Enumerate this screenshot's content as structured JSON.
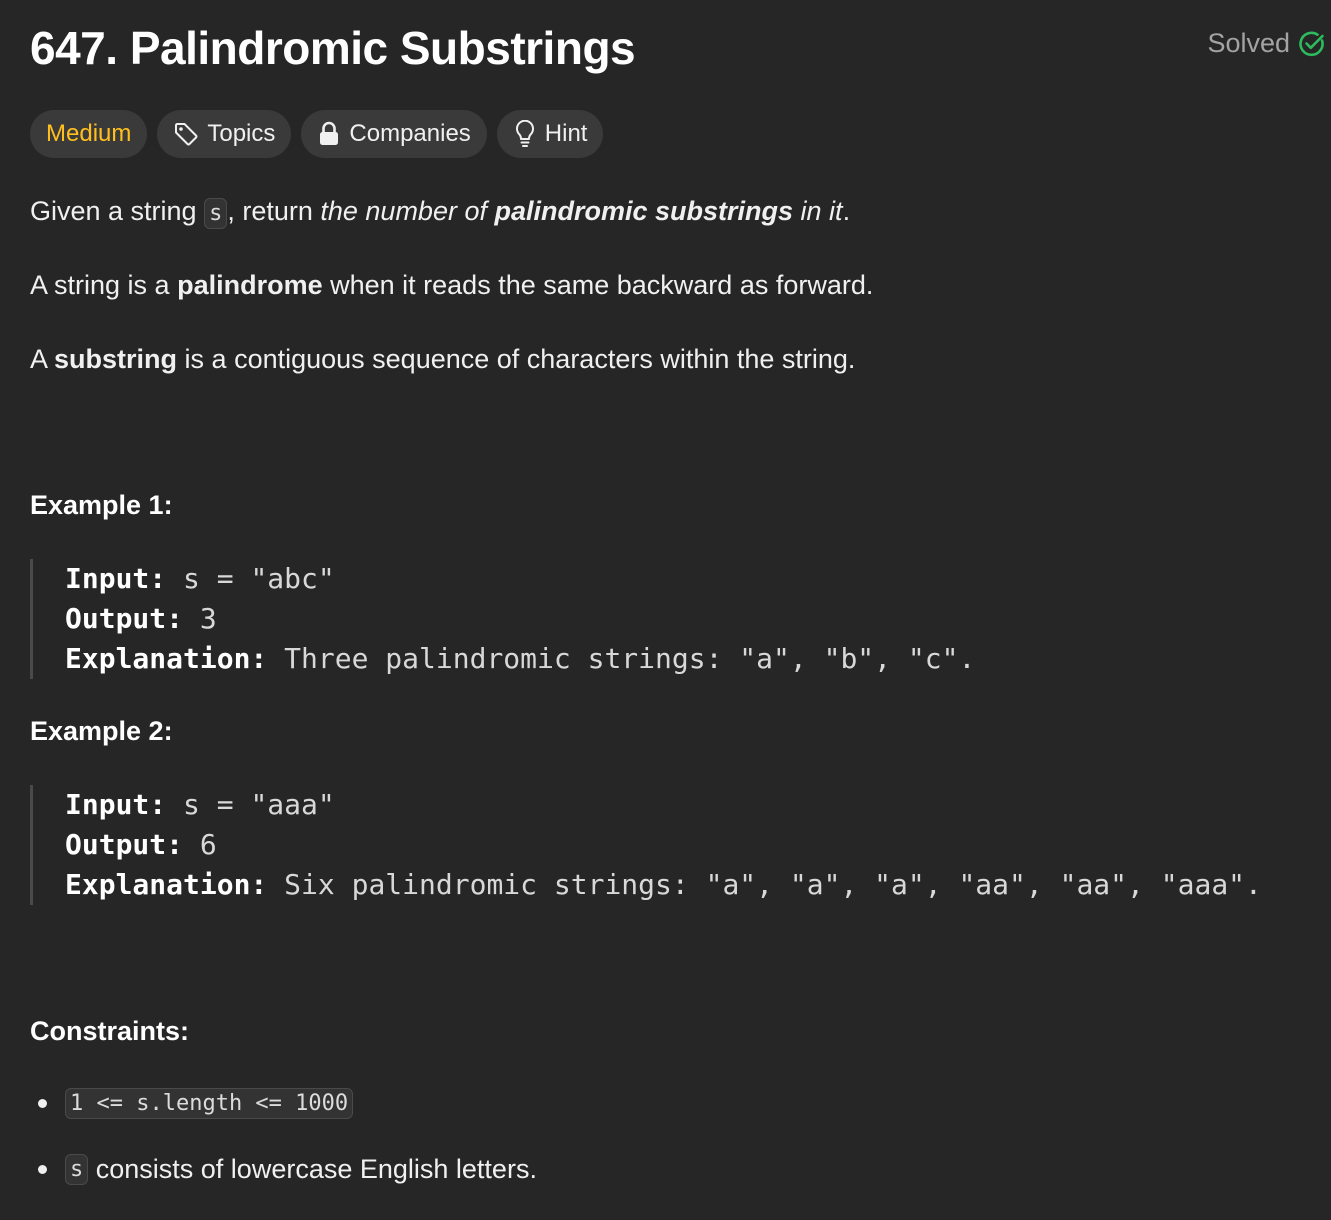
{
  "problem": {
    "number": "647.",
    "title": "Palindromic Substrings",
    "status": "Solved",
    "colors": {
      "background": "#262626",
      "difficulty": "#ffc01e",
      "solved_check": "#2cbb5d"
    }
  },
  "tags": {
    "difficulty": "Medium",
    "topics": "Topics",
    "companies": "Companies",
    "hint": "Hint",
    "topics_icon": "tag-icon",
    "companies_icon": "lock-icon",
    "hint_icon": "lightbulb-icon"
  },
  "description": {
    "p1_a": "Given a string ",
    "p1_code": "s",
    "p1_b": ", return ",
    "p1_c": "the number of ",
    "p1_d": "palindromic substrings",
    "p1_e": " in it",
    "p1_f": ".",
    "p2_a": "A string is a ",
    "p2_b": "palindrome",
    "p2_c": " when it reads the same backward as forward.",
    "p3_a": "A ",
    "p3_b": "substring",
    "p3_c": " is a contiguous sequence of characters within the string."
  },
  "examples": [
    {
      "heading": "Example 1:",
      "input_label": "Input:",
      "input_value": " s = \"abc\"",
      "output_label": "Output:",
      "output_value": " 3",
      "explanation_label": "Explanation:",
      "explanation_value": " Three palindromic strings: \"a\", \"b\", \"c\"."
    },
    {
      "heading": "Example 2:",
      "input_label": "Input:",
      "input_value": " s = \"aaa\"",
      "output_label": "Output:",
      "output_value": " 6",
      "explanation_label": "Explanation:",
      "explanation_value": " Six palindromic strings: \"a\", \"a\", \"a\", \"aa\", \"aa\", \"aaa\"."
    }
  ],
  "constraints": {
    "heading": "Constraints:",
    "c1_code": "1 <= s.length <= 1000",
    "c2_code": "s",
    "c2_text": " consists of lowercase English letters."
  }
}
